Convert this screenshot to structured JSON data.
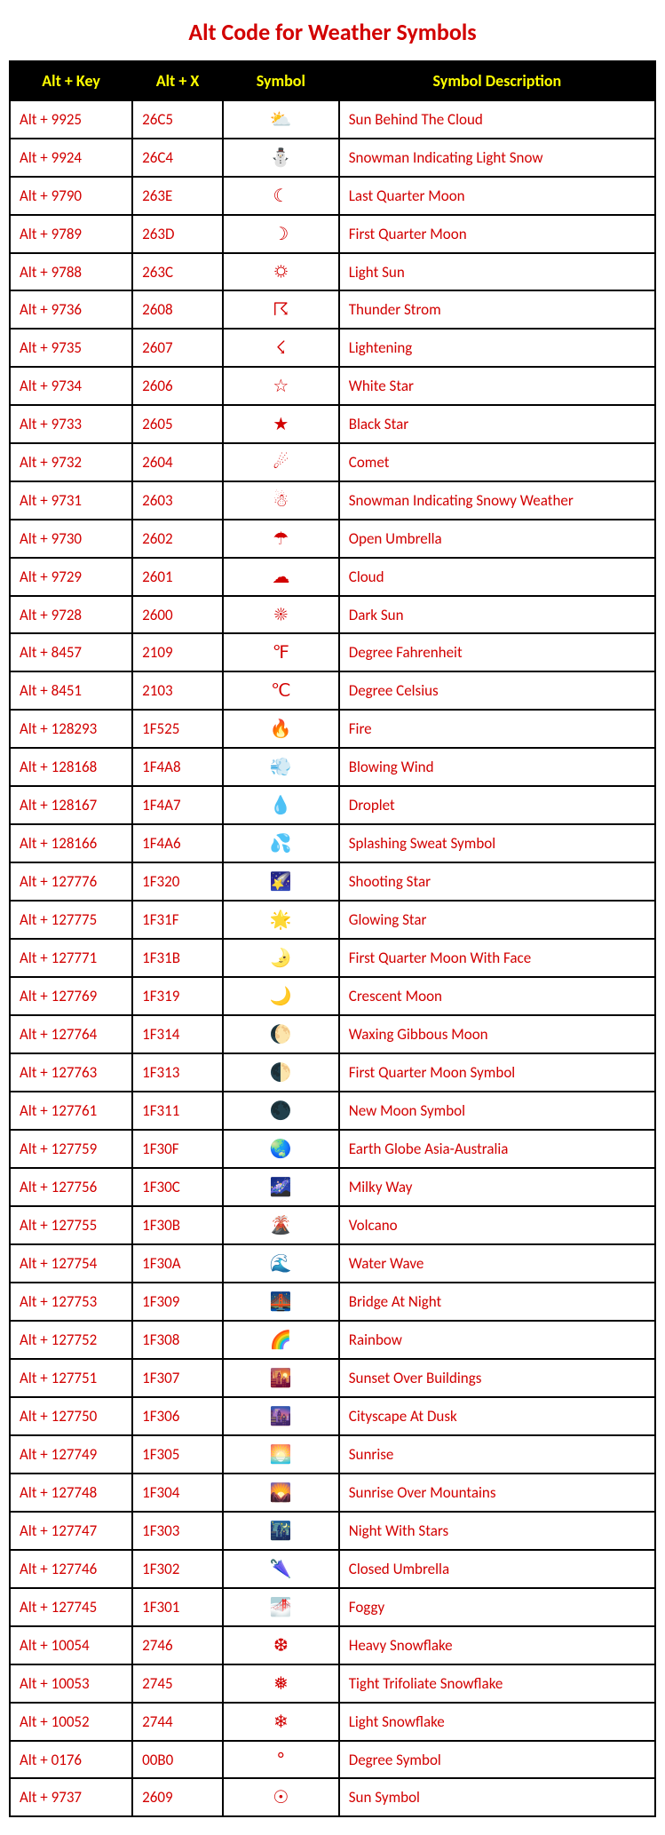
{
  "title": "Alt Code for Weather Symbols",
  "headers": [
    "Alt + Key",
    "Alt + X",
    "Symbol",
    "Symbol Description"
  ],
  "chart_data": {
    "type": "table",
    "columns": [
      "Alt + Key",
      "Alt + X",
      "Symbol",
      "Symbol Description"
    ],
    "rows": [
      {
        "altKey": "Alt + 9925",
        "altX": "26C5",
        "symbol": "⛅",
        "description": "Sun Behind The Cloud"
      },
      {
        "altKey": "Alt + 9924",
        "altX": "26C4",
        "symbol": "⛄",
        "description": "Snowman Indicating Light Snow"
      },
      {
        "altKey": "Alt + 9790",
        "altX": "263E",
        "symbol": "☾",
        "description": "Last Quarter Moon"
      },
      {
        "altKey": "Alt + 9789",
        "altX": "263D",
        "symbol": "☽",
        "description": "First Quarter Moon"
      },
      {
        "altKey": "Alt + 9788",
        "altX": "263C",
        "symbol": "☼",
        "description": "Light Sun"
      },
      {
        "altKey": "Alt + 9736",
        "altX": "2608",
        "symbol": "☈",
        "description": "Thunder Strom"
      },
      {
        "altKey": "Alt + 9735",
        "altX": "2607",
        "symbol": "☇",
        "description": "Lightening"
      },
      {
        "altKey": "Alt + 9734",
        "altX": "2606",
        "symbol": "☆",
        "description": "White Star"
      },
      {
        "altKey": "Alt + 9733",
        "altX": "2605",
        "symbol": "★",
        "description": "Black Star"
      },
      {
        "altKey": "Alt + 9732",
        "altX": "2604",
        "symbol": "☄",
        "description": "Comet"
      },
      {
        "altKey": "Alt + 9731",
        "altX": "2603",
        "symbol": "☃",
        "description": "Snowman Indicating Snowy Weather"
      },
      {
        "altKey": "Alt + 9730",
        "altX": "2602",
        "symbol": "☂",
        "description": "Open Umbrella"
      },
      {
        "altKey": "Alt + 9729",
        "altX": "2601",
        "symbol": "☁",
        "description": "Cloud"
      },
      {
        "altKey": "Alt + 9728",
        "altX": "2600",
        "symbol": "☀",
        "description": "Dark Sun"
      },
      {
        "altKey": "Alt + 8457",
        "altX": "2109",
        "symbol": "℉",
        "description": "Degree Fahrenheit"
      },
      {
        "altKey": "Alt + 8451",
        "altX": "2103",
        "symbol": "℃",
        "description": "Degree Celsius"
      },
      {
        "altKey": "Alt + 128293",
        "altX": "1F525",
        "symbol": "🔥",
        "description": "Fire"
      },
      {
        "altKey": "Alt + 128168",
        "altX": "1F4A8",
        "symbol": "💨",
        "description": "Blowing Wind"
      },
      {
        "altKey": "Alt + 128167",
        "altX": "1F4A7",
        "symbol": "💧",
        "description": "Droplet"
      },
      {
        "altKey": "Alt + 128166",
        "altX": "1F4A6",
        "symbol": "💦",
        "description": "Splashing Sweat Symbol"
      },
      {
        "altKey": "Alt + 127776",
        "altX": "1F320",
        "symbol": "🌠",
        "description": "Shooting Star"
      },
      {
        "altKey": "Alt + 127775",
        "altX": "1F31F",
        "symbol": "🌟",
        "description": "Glowing Star"
      },
      {
        "altKey": "Alt + 127771",
        "altX": "1F31B",
        "symbol": "🌛",
        "description": "First Quarter Moon With Face"
      },
      {
        "altKey": "Alt + 127769",
        "altX": "1F319",
        "symbol": "🌙",
        "description": "Crescent Moon"
      },
      {
        "altKey": "Alt + 127764",
        "altX": "1F314",
        "symbol": "🌔",
        "description": "Waxing Gibbous Moon"
      },
      {
        "altKey": "Alt + 127763",
        "altX": "1F313",
        "symbol": "🌓",
        "description": "First Quarter Moon Symbol"
      },
      {
        "altKey": "Alt + 127761",
        "altX": "1F311",
        "symbol": "🌑",
        "description": "New Moon Symbol"
      },
      {
        "altKey": "Alt + 127759",
        "altX": "1F30F",
        "symbol": "🌏",
        "description": "Earth Globe Asia-Australia"
      },
      {
        "altKey": "Alt + 127756",
        "altX": "1F30C",
        "symbol": "🌌",
        "description": "Milky Way"
      },
      {
        "altKey": "Alt + 127755",
        "altX": "1F30B",
        "symbol": "🌋",
        "description": "Volcano"
      },
      {
        "altKey": "Alt + 127754",
        "altX": "1F30A",
        "symbol": "🌊",
        "description": "Water Wave"
      },
      {
        "altKey": "Alt + 127753",
        "altX": "1F309",
        "symbol": "🌉",
        "description": "Bridge At Night"
      },
      {
        "altKey": "Alt + 127752",
        "altX": "1F308",
        "symbol": "🌈",
        "description": "Rainbow"
      },
      {
        "altKey": "Alt + 127751",
        "altX": "1F307",
        "symbol": "🌇",
        "description": "Sunset Over Buildings"
      },
      {
        "altKey": "Alt + 127750",
        "altX": "1F306",
        "symbol": "🌆",
        "description": "Cityscape At Dusk"
      },
      {
        "altKey": "Alt + 127749",
        "altX": "1F305",
        "symbol": "🌅",
        "description": "Sunrise"
      },
      {
        "altKey": "Alt + 127748",
        "altX": "1F304",
        "symbol": "🌄",
        "description": "Sunrise Over Mountains"
      },
      {
        "altKey": "Alt + 127747",
        "altX": "1F303",
        "symbol": "🌃",
        "description": "Night With Stars"
      },
      {
        "altKey": "Alt + 127746",
        "altX": "1F302",
        "symbol": "🌂",
        "description": "Closed Umbrella"
      },
      {
        "altKey": "Alt + 127745",
        "altX": "1F301",
        "symbol": "🌁",
        "description": "Foggy"
      },
      {
        "altKey": "Alt + 10054",
        "altX": "2746",
        "symbol": "❆",
        "description": "Heavy Snowflake"
      },
      {
        "altKey": "Alt + 10053",
        "altX": "2745",
        "symbol": "❅",
        "description": "Tight Trifoliate Snowflake"
      },
      {
        "altKey": "Alt + 10052",
        "altX": "2744",
        "symbol": "❄",
        "description": "Light Snowflake"
      },
      {
        "altKey": "Alt + 0176",
        "altX": "00B0",
        "symbol": "°",
        "description": "Degree Symbol"
      },
      {
        "altKey": "Alt + 9737",
        "altX": "2609",
        "symbol": "☉",
        "description": "Sun Symbol"
      }
    ]
  }
}
